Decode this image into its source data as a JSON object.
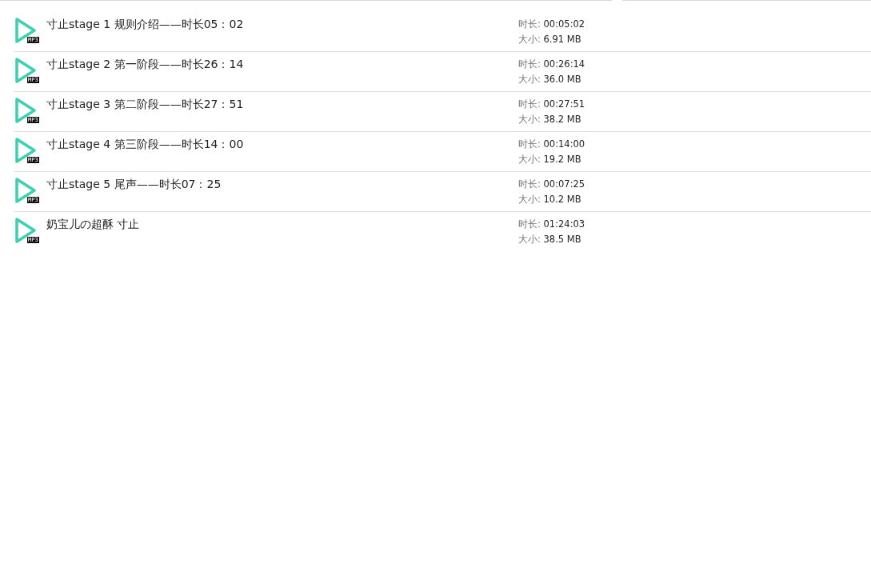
{
  "files": [
    {
      "name": "寸止stage 1 规则介绍——时长05：02",
      "badge": "MP3",
      "duration_label": "时长:",
      "duration": "00:05:02",
      "size_label": "大小:",
      "size": "6.91 MB"
    },
    {
      "name": "寸止stage 2 第一阶段——时长26：14",
      "badge": "MP3",
      "duration_label": "时长:",
      "duration": "00:26:14",
      "size_label": "大小:",
      "size": "36.0 MB"
    },
    {
      "name": "寸止stage 3 第二阶段——时长27：51",
      "badge": "MP3",
      "duration_label": "时长:",
      "duration": "00:27:51",
      "size_label": "大小:",
      "size": "38.2 MB"
    },
    {
      "name": "寸止stage 4 第三阶段——时长14：00",
      "badge": "MP3",
      "duration_label": "时长:",
      "duration": "00:14:00",
      "size_label": "大小:",
      "size": "19.2 MB"
    },
    {
      "name": "寸止stage 5 尾声——时长07：25",
      "badge": "MP3",
      "duration_label": "时长:",
      "duration": "00:07:25",
      "size_label": "大小:",
      "size": "10.2 MB"
    },
    {
      "name": "奶宝儿の超酥 寸止",
      "badge": "MP3",
      "duration_label": "时长:",
      "duration": "01:24:03",
      "size_label": "大小:",
      "size": "38.5 MB"
    }
  ]
}
